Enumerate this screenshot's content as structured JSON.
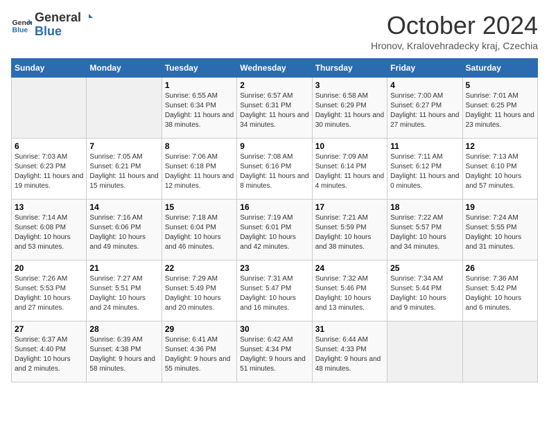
{
  "header": {
    "logo_line1": "General",
    "logo_line2": "Blue",
    "month": "October 2024",
    "location": "Hronov, Kralovehradecky kraj, Czechia"
  },
  "weekdays": [
    "Sunday",
    "Monday",
    "Tuesday",
    "Wednesday",
    "Thursday",
    "Friday",
    "Saturday"
  ],
  "weeks": [
    [
      {
        "day": "",
        "info": ""
      },
      {
        "day": "",
        "info": ""
      },
      {
        "day": "1",
        "info": "Sunrise: 6:55 AM\nSunset: 6:34 PM\nDaylight: 11 hours and 38 minutes."
      },
      {
        "day": "2",
        "info": "Sunrise: 6:57 AM\nSunset: 6:31 PM\nDaylight: 11 hours and 34 minutes."
      },
      {
        "day": "3",
        "info": "Sunrise: 6:58 AM\nSunset: 6:29 PM\nDaylight: 11 hours and 30 minutes."
      },
      {
        "day": "4",
        "info": "Sunrise: 7:00 AM\nSunset: 6:27 PM\nDaylight: 11 hours and 27 minutes."
      },
      {
        "day": "5",
        "info": "Sunrise: 7:01 AM\nSunset: 6:25 PM\nDaylight: 11 hours and 23 minutes."
      }
    ],
    [
      {
        "day": "6",
        "info": "Sunrise: 7:03 AM\nSunset: 6:23 PM\nDaylight: 11 hours and 19 minutes."
      },
      {
        "day": "7",
        "info": "Sunrise: 7:05 AM\nSunset: 6:21 PM\nDaylight: 11 hours and 15 minutes."
      },
      {
        "day": "8",
        "info": "Sunrise: 7:06 AM\nSunset: 6:18 PM\nDaylight: 11 hours and 12 minutes."
      },
      {
        "day": "9",
        "info": "Sunrise: 7:08 AM\nSunset: 6:16 PM\nDaylight: 11 hours and 8 minutes."
      },
      {
        "day": "10",
        "info": "Sunrise: 7:09 AM\nSunset: 6:14 PM\nDaylight: 11 hours and 4 minutes."
      },
      {
        "day": "11",
        "info": "Sunrise: 7:11 AM\nSunset: 6:12 PM\nDaylight: 11 hours and 0 minutes."
      },
      {
        "day": "12",
        "info": "Sunrise: 7:13 AM\nSunset: 6:10 PM\nDaylight: 10 hours and 57 minutes."
      }
    ],
    [
      {
        "day": "13",
        "info": "Sunrise: 7:14 AM\nSunset: 6:08 PM\nDaylight: 10 hours and 53 minutes."
      },
      {
        "day": "14",
        "info": "Sunrise: 7:16 AM\nSunset: 6:06 PM\nDaylight: 10 hours and 49 minutes."
      },
      {
        "day": "15",
        "info": "Sunrise: 7:18 AM\nSunset: 6:04 PM\nDaylight: 10 hours and 46 minutes."
      },
      {
        "day": "16",
        "info": "Sunrise: 7:19 AM\nSunset: 6:01 PM\nDaylight: 10 hours and 42 minutes."
      },
      {
        "day": "17",
        "info": "Sunrise: 7:21 AM\nSunset: 5:59 PM\nDaylight: 10 hours and 38 minutes."
      },
      {
        "day": "18",
        "info": "Sunrise: 7:22 AM\nSunset: 5:57 PM\nDaylight: 10 hours and 34 minutes."
      },
      {
        "day": "19",
        "info": "Sunrise: 7:24 AM\nSunset: 5:55 PM\nDaylight: 10 hours and 31 minutes."
      }
    ],
    [
      {
        "day": "20",
        "info": "Sunrise: 7:26 AM\nSunset: 5:53 PM\nDaylight: 10 hours and 27 minutes."
      },
      {
        "day": "21",
        "info": "Sunrise: 7:27 AM\nSunset: 5:51 PM\nDaylight: 10 hours and 24 minutes."
      },
      {
        "day": "22",
        "info": "Sunrise: 7:29 AM\nSunset: 5:49 PM\nDaylight: 10 hours and 20 minutes."
      },
      {
        "day": "23",
        "info": "Sunrise: 7:31 AM\nSunset: 5:47 PM\nDaylight: 10 hours and 16 minutes."
      },
      {
        "day": "24",
        "info": "Sunrise: 7:32 AM\nSunset: 5:46 PM\nDaylight: 10 hours and 13 minutes."
      },
      {
        "day": "25",
        "info": "Sunrise: 7:34 AM\nSunset: 5:44 PM\nDaylight: 10 hours and 9 minutes."
      },
      {
        "day": "26",
        "info": "Sunrise: 7:36 AM\nSunset: 5:42 PM\nDaylight: 10 hours and 6 minutes."
      }
    ],
    [
      {
        "day": "27",
        "info": "Sunrise: 6:37 AM\nSunset: 4:40 PM\nDaylight: 10 hours and 2 minutes."
      },
      {
        "day": "28",
        "info": "Sunrise: 6:39 AM\nSunset: 4:38 PM\nDaylight: 9 hours and 58 minutes."
      },
      {
        "day": "29",
        "info": "Sunrise: 6:41 AM\nSunset: 4:36 PM\nDaylight: 9 hours and 55 minutes."
      },
      {
        "day": "30",
        "info": "Sunrise: 6:42 AM\nSunset: 4:34 PM\nDaylight: 9 hours and 51 minutes."
      },
      {
        "day": "31",
        "info": "Sunrise: 6:44 AM\nSunset: 4:33 PM\nDaylight: 9 hours and 48 minutes."
      },
      {
        "day": "",
        "info": ""
      },
      {
        "day": "",
        "info": ""
      }
    ]
  ]
}
